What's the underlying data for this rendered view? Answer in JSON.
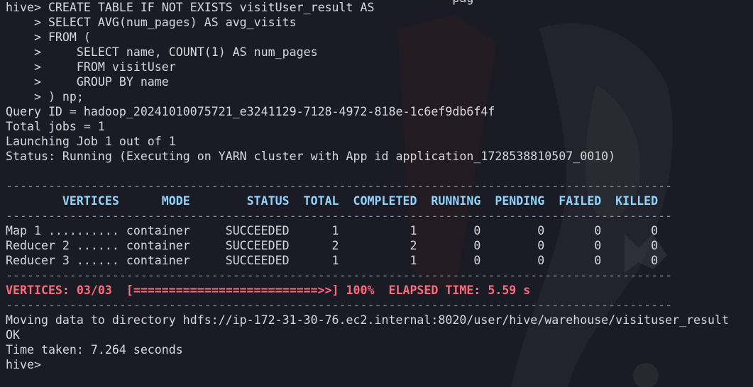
{
  "terminal": {
    "cut_line": "                                                               pag",
    "lines": [
      {
        "text": "hive> CREATE TABLE IF NOT EXISTS visitUser_result AS",
        "style": "normal"
      },
      {
        "text": "    > SELECT AVG(num_pages) AS avg_visits",
        "style": "normal"
      },
      {
        "text": "    > FROM (",
        "style": "normal"
      },
      {
        "text": "    >     SELECT name, COUNT(1) AS num_pages",
        "style": "normal"
      },
      {
        "text": "    >     FROM visitUser",
        "style": "normal"
      },
      {
        "text": "    >     GROUP BY name",
        "style": "normal"
      },
      {
        "text": "    > ) np;",
        "style": "normal"
      },
      {
        "text": "Query ID = hadoop_20241010075721_e3241129-7128-4972-818e-1c6ef9db6f4f",
        "style": "normal"
      },
      {
        "text": "Total jobs = 1",
        "style": "normal"
      },
      {
        "text": "Launching Job 1 out of 1",
        "style": "normal"
      },
      {
        "text": "Status: Running (Executing on YARN cluster with App id application_1728538810507_0010)",
        "style": "normal"
      },
      {
        "text": "",
        "style": "normal"
      },
      {
        "text": "----------------------------------------------------------------------------------------------",
        "style": "dash"
      },
      {
        "text": "        VERTICES      MODE        STATUS  TOTAL  COMPLETED  RUNNING  PENDING  FAILED  KILLED",
        "style": "hdr"
      },
      {
        "text": "----------------------------------------------------------------------------------------------",
        "style": "dash"
      },
      {
        "text": "Map 1 .......... container     SUCCEEDED      1          1        0        0       0       0",
        "style": "normal"
      },
      {
        "text": "Reducer 2 ...... container     SUCCEEDED      2          2        0        0       0       0",
        "style": "normal"
      },
      {
        "text": "Reducer 3 ...... container     SUCCEEDED      1          1        0        0       0       0",
        "style": "normal"
      },
      {
        "text": "----------------------------------------------------------------------------------------------",
        "style": "dash"
      },
      {
        "text": "VERTICES: 03/03  [==========================>>] 100%  ELAPSED TIME: 5.59 s",
        "style": "progress"
      },
      {
        "text": "----------------------------------------------------------------------------------------------",
        "style": "dash"
      },
      {
        "text": "Moving data to directory hdfs://ip-172-31-30-76.ec2.internal:8020/user/hive/warehouse/visituser_result",
        "style": "normal"
      },
      {
        "text": "OK",
        "style": "normal"
      },
      {
        "text": "Time taken: 7.264 seconds",
        "style": "normal"
      },
      {
        "text": "hive>",
        "style": "normal"
      }
    ]
  }
}
